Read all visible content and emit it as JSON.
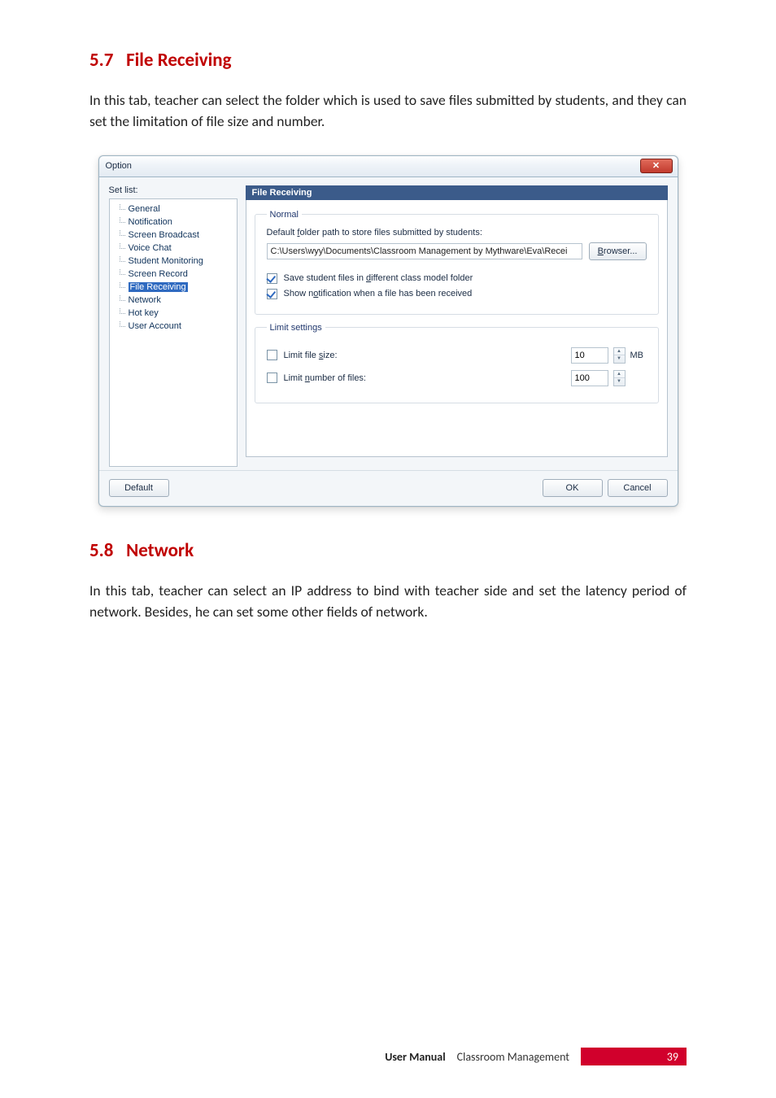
{
  "section1": {
    "heading_num": "5.7",
    "heading_title": "File Receiving",
    "para": "In this tab, teacher can select the folder which is used to save files submitted by students, and they can set the limitation of file size and number."
  },
  "section2": {
    "heading_num": "5.8",
    "heading_title": "Network",
    "para": "In this tab, teacher can select an IP address to bind with teacher side and set the latency period of network. Besides, he can set some other fields of network."
  },
  "dialog": {
    "title": "Option",
    "close_glyph": "✕",
    "set_list_label": "Set list:",
    "tree_items": [
      {
        "label": "General",
        "selected": false
      },
      {
        "label": "Notification",
        "selected": false
      },
      {
        "label": "Screen Broadcast",
        "selected": false
      },
      {
        "label": "Voice Chat",
        "selected": false
      },
      {
        "label": "Student Monitoring",
        "selected": false
      },
      {
        "label": "Screen Record",
        "selected": false
      },
      {
        "label": "File Receiving",
        "selected": true
      },
      {
        "label": "Network",
        "selected": false
      },
      {
        "label": "Hot key",
        "selected": false
      },
      {
        "label": "User Account",
        "selected": false
      }
    ],
    "panel_title": "File Receiving",
    "normal_group": {
      "legend": "Normal",
      "folder_label_pre": "Default ",
      "folder_label_u": "f",
      "folder_label_post": "older path to store files submitted by students:",
      "path": "C:\\Users\\wyy\\Documents\\Classroom Management by Mythware\\Eva\\Recei",
      "browse_pre": "",
      "browse_u": "B",
      "browse_post": "rowser...",
      "chk_save": {
        "checked": true,
        "pre": "Save student files in ",
        "u": "d",
        "post": "ifferent class model folder"
      },
      "chk_notify": {
        "checked": true,
        "pre": "Show n",
        "u": "o",
        "post": "tification when a file has been received"
      }
    },
    "limit_group": {
      "legend": "Limit settings",
      "size": {
        "checked": false,
        "pre": "Limit file ",
        "u": "s",
        "post": "ize:",
        "value": "10",
        "unit": "MB"
      },
      "num": {
        "checked": false,
        "pre": "Limit ",
        "u": "n",
        "post": "umber of files:",
        "value": "100"
      }
    },
    "footer": {
      "default_label": "Default",
      "ok_label": "OK",
      "cancel_label": "Cancel"
    }
  },
  "footer": {
    "manual": "User Manual",
    "product": "Classroom Management",
    "page": "39"
  }
}
